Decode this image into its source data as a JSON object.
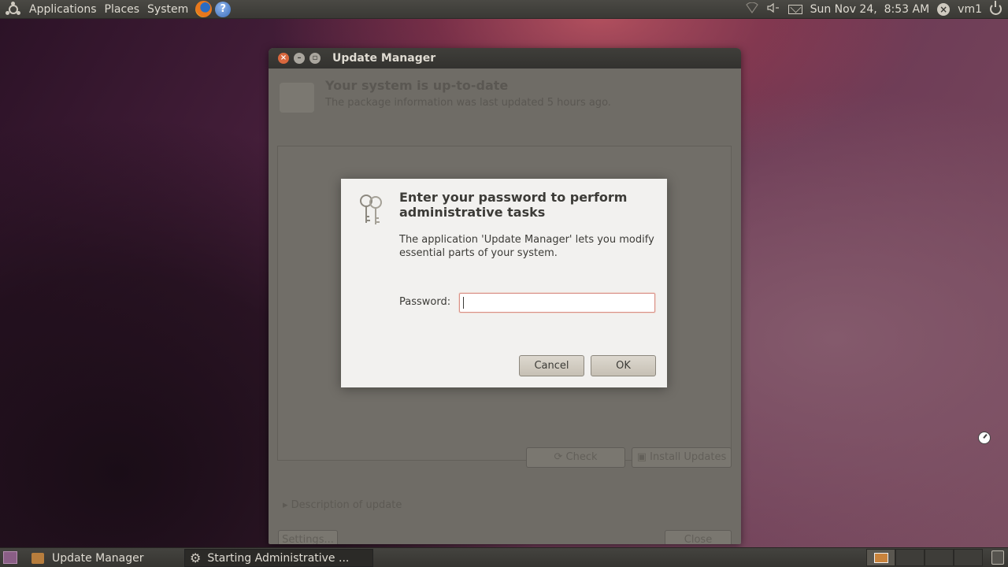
{
  "top_panel": {
    "menus": [
      "Applications",
      "Places",
      "System"
    ],
    "clock": "Sun Nov 24,  8:53 AM",
    "user": "vm1"
  },
  "update_manager": {
    "title": "Update Manager",
    "heading": "Your system is up-to-date",
    "subtext": "The package information was last updated 5 hours ago.",
    "check_label": "Check",
    "install_label": "Install Updates",
    "description_label": "Description of update",
    "settings_label": "Settings...",
    "close_label": "Close"
  },
  "auth_dialog": {
    "heading": "Enter your password to perform administrative tasks",
    "message": "The application 'Update Manager' lets you modify essential parts of your system.",
    "password_label": "Password:",
    "password_value": "",
    "cancel_label": "Cancel",
    "ok_label": "OK"
  },
  "bottom_panel": {
    "tasks": [
      "Update Manager",
      "Starting Administrative ..."
    ]
  }
}
